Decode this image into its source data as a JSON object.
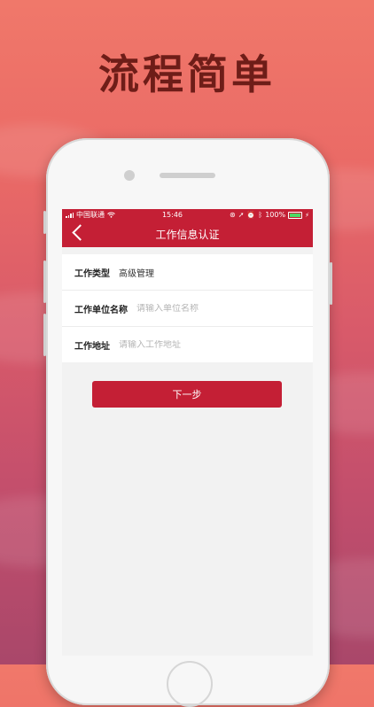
{
  "headline": "流程简单",
  "status_bar": {
    "carrier": "中国联通",
    "time": "15:46",
    "battery_percent": "100%",
    "battery_level": 1.0
  },
  "nav": {
    "title": "工作信息认证"
  },
  "form": {
    "job_type": {
      "label": "工作类型",
      "value": "高级管理"
    },
    "company_name": {
      "label": "工作单位名称",
      "placeholder": "请输入单位名称"
    },
    "work_address": {
      "label": "工作地址",
      "placeholder": "请输入工作地址"
    }
  },
  "next_button": {
    "label": "下一步"
  },
  "colors": {
    "brand": "#c41f35",
    "headline": "#6e1d18",
    "battery": "#4cd964"
  }
}
